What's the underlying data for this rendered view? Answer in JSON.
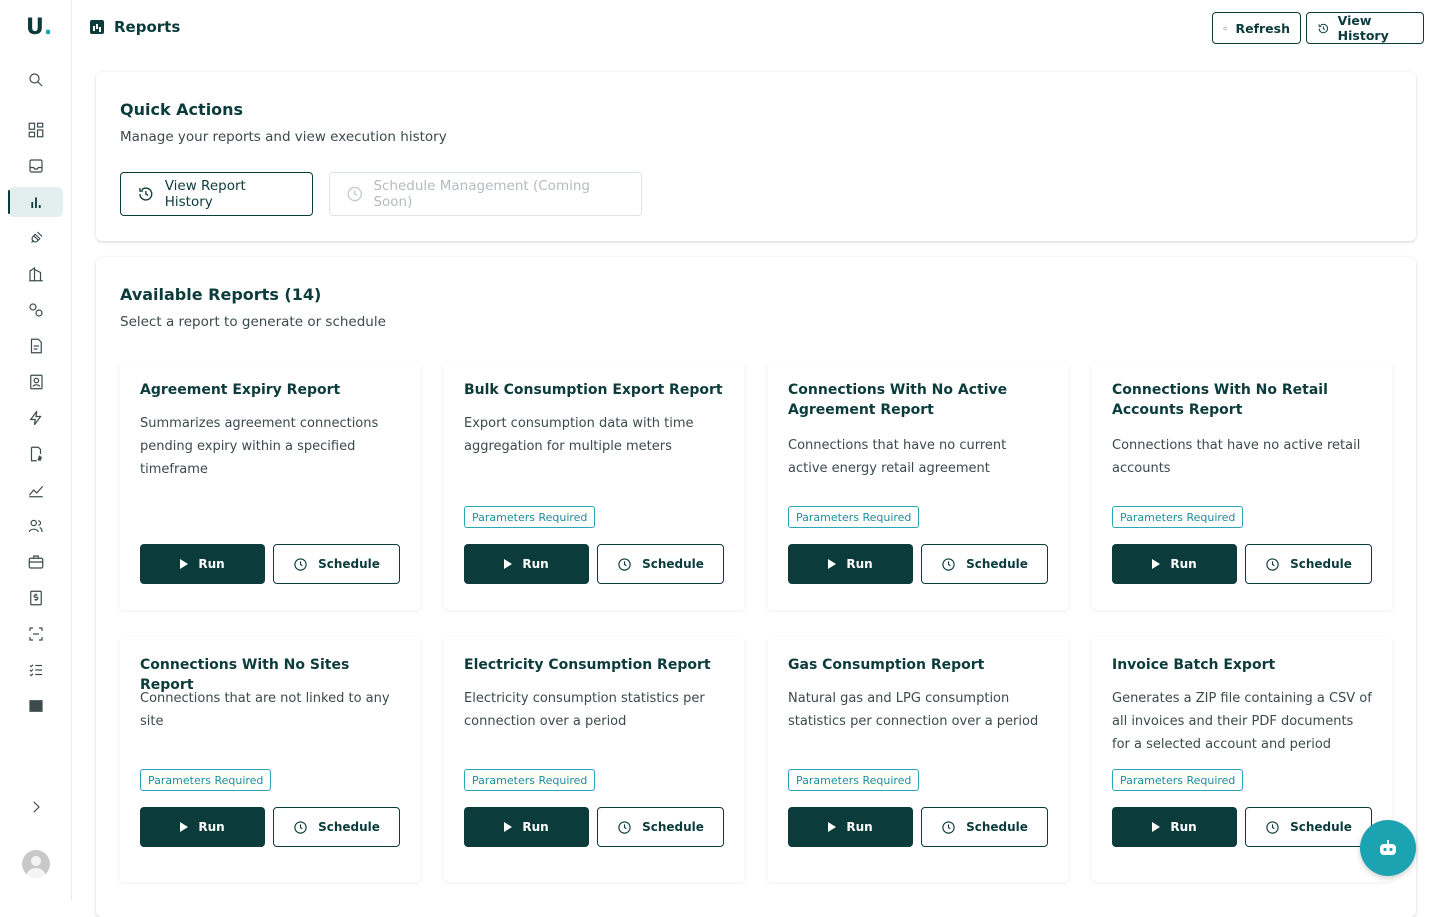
{
  "app": {
    "logo_text": "U",
    "logo_dot": "."
  },
  "header": {
    "title": "Reports",
    "refresh_label": "Refresh",
    "view_history_label": "View History"
  },
  "quick_actions": {
    "title": "Quick Actions",
    "subtitle": "Manage your reports and view execution history",
    "view_report_history_label": "View Report History",
    "schedule_management_label": "Schedule Management (Coming Soon)"
  },
  "available_reports": {
    "title": "Available Reports (14)",
    "subtitle": "Select a report to generate or schedule",
    "run_label": "Run",
    "schedule_label": "Schedule",
    "badge_label": "Parameters Required",
    "cards": [
      {
        "title": "Agreement Expiry Report",
        "description": "Summarizes agreement connections pending expiry within a specified timeframe",
        "params_required": false
      },
      {
        "title": "Bulk Consumption Export Report",
        "description": "Export consumption data with time aggregation for multiple meters",
        "params_required": true
      },
      {
        "title": "Connections With No Active Agreement Report",
        "description": "Connections that have no current active energy retail agreement",
        "params_required": true
      },
      {
        "title": "Connections With No Retail Accounts Report",
        "description": "Connections that have no active retail accounts",
        "params_required": true
      },
      {
        "title": "Connections With No Sites Report",
        "description": "Connections that are not linked to any site",
        "params_required": true
      },
      {
        "title": "Electricity Consumption Report",
        "description": "Electricity consumption statistics per connection over a period",
        "params_required": true
      },
      {
        "title": "Gas Consumption Report",
        "description": "Natural gas and LPG consumption statistics per connection over a period",
        "params_required": true
      },
      {
        "title": "Invoice Batch Export",
        "description": "Generates a ZIP file containing a CSV of all invoices and their PDF documents for a selected account and period",
        "params_required": true
      }
    ]
  },
  "sidebar": {
    "items": [
      {
        "icon": "search-icon"
      },
      {
        "icon": "dashboard-icon"
      },
      {
        "icon": "inbox-icon"
      },
      {
        "icon": "reports-icon",
        "active": true
      },
      {
        "icon": "plug-icon"
      },
      {
        "icon": "building-icon"
      },
      {
        "icon": "location-icon"
      },
      {
        "icon": "document-icon"
      },
      {
        "icon": "contacts-icon"
      },
      {
        "icon": "lightning-icon"
      },
      {
        "icon": "billing-icon"
      },
      {
        "icon": "analytics-icon"
      },
      {
        "icon": "users-icon"
      },
      {
        "icon": "briefcase-icon"
      },
      {
        "icon": "invoice-icon"
      },
      {
        "icon": "scan-icon"
      },
      {
        "icon": "checklist-icon"
      },
      {
        "icon": "table-icon"
      }
    ],
    "expand_icon": "chevron-right-icon"
  },
  "colors": {
    "primary": "#0c3b3c",
    "accent": "#1ba3b2",
    "badge": "#2aa7b5"
  }
}
